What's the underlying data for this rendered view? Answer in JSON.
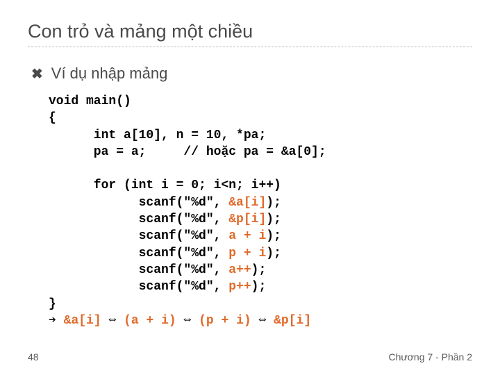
{
  "title": "Con trỏ và mảng một chiều",
  "bullet": "Ví dụ nhập mảng",
  "code": {
    "l1": "void main()",
    "l2": "{",
    "l3": "      int a[10], n = 10, *pa;",
    "l4": "      pa = a;     // hoặc pa = &a[0];",
    "l5": "",
    "l6": "      for (int i = 0; i<n; i++)",
    "l7a": "            scanf(\"%d\", ",
    "l7b": "&a[i]",
    "l7c": ");",
    "l8a": "            scanf(\"%d\", ",
    "l8b": "&p[i]",
    "l8c": ");",
    "l9a": "            scanf(\"%d\", ",
    "l9b": "a + i",
    "l9c": ");",
    "l10a": "            scanf(\"%d\", ",
    "l10b": "p + i",
    "l10c": ");",
    "l11a": "            scanf(\"%d\", ",
    "l11b": "a++",
    "l11c": ");",
    "l12a": "            scanf(\"%d\", ",
    "l12b": "p++",
    "l12c": ");",
    "l13": "}",
    "l14a": "➔ ",
    "l14b": "&a[i]",
    "l14c": " ⇔ ",
    "l14d": "(a + i)",
    "l14e": " ⇔ ",
    "l14f": "(p + i)",
    "l14g": " ⇔ ",
    "l14h": "&p[i]"
  },
  "footer": {
    "page": "48",
    "chapter": "Chương 7 - Phần 2"
  }
}
